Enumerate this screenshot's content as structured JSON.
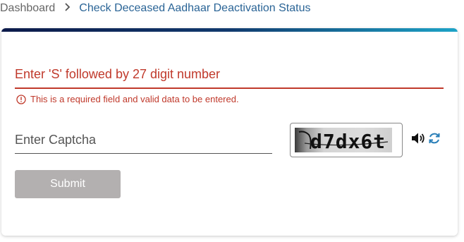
{
  "breadcrumb": {
    "home": "Dashboard",
    "current": "Check Deceased Aadhaar Deactivation Status"
  },
  "form": {
    "uid_placeholder": "Enter 'S' followed by 27 digit number",
    "error_message": "This is a required field and valid data to be entered.",
    "captcha_placeholder": "Enter Captcha",
    "captcha_text": "d7dx6t",
    "submit_label": "Submit"
  },
  "icons": {
    "error": "error-circle-icon",
    "audio": "speaker-icon",
    "refresh": "refresh-icon"
  },
  "colors": {
    "error": "#c0392b",
    "link": "#2a6496",
    "submit_disabled": "#b3b0b0",
    "accent_refresh": "#2a7fb8"
  }
}
